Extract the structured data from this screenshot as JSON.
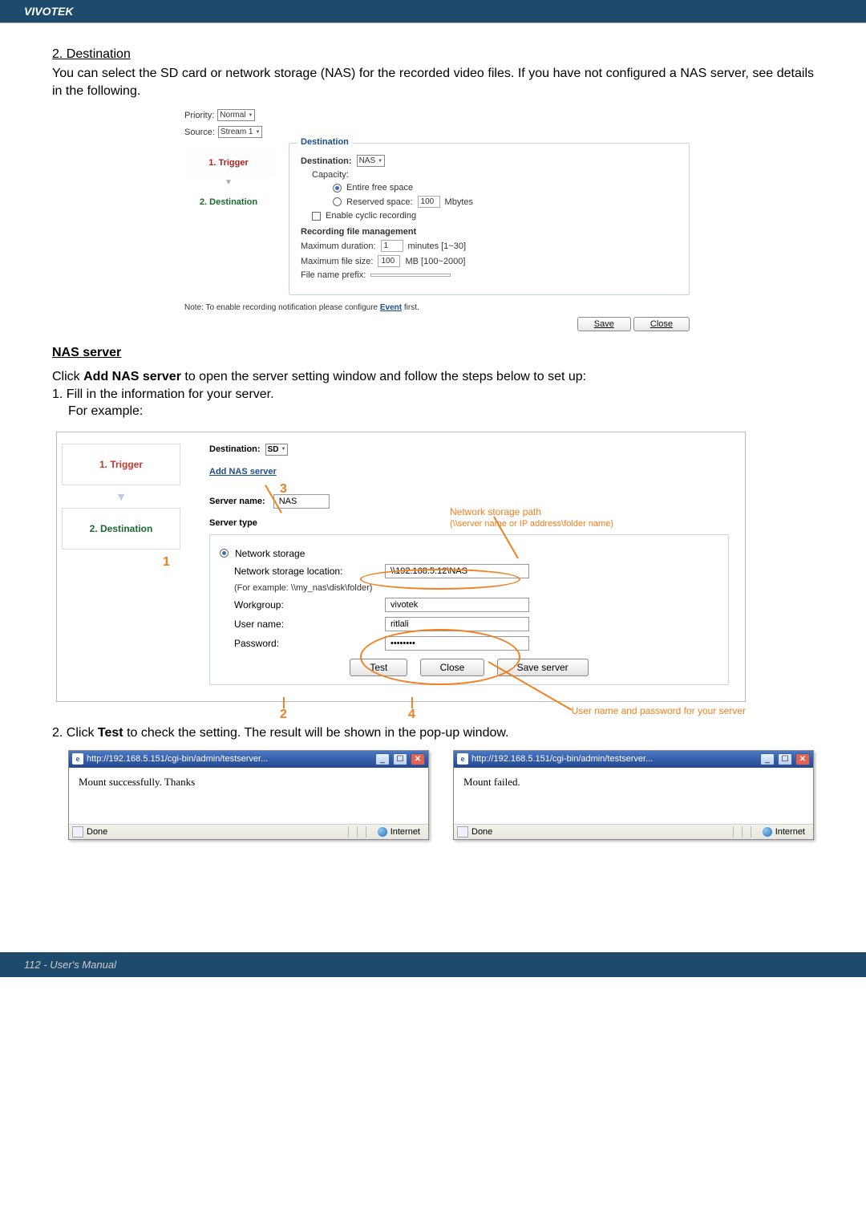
{
  "header": {
    "brand": "VIVOTEK"
  },
  "section_dest": {
    "num_title": "2. Destination",
    "para": "You can select the SD card or network storage (NAS) for the recorded video files. If you have not configured a NAS server, see details in the following."
  },
  "shot1": {
    "priority_label": "Priority:",
    "priority_value": "Normal",
    "source_label": "Source:",
    "source_value": "Stream 1",
    "step1": "1. Trigger",
    "step2": "2. Destination",
    "fs_legend": "Destination",
    "dest_label": "Destination:",
    "dest_value": "NAS",
    "capacity_label": "Capacity:",
    "entire": "Entire free space",
    "reserved": "Reserved space:",
    "reserved_val": "100",
    "reserved_unit": "Mbytes",
    "cyclic": "Enable cyclic recording",
    "rfm_label": "Recording file management",
    "maxdur": "Maximum duration:",
    "maxdur_val": "1",
    "maxdur_unit": "minutes [1~30]",
    "maxsize": "Maximum file size:",
    "maxsize_val": "100",
    "maxsize_unit": "MB [100~2000]",
    "prefix": "File name prefix:",
    "note_pre": "Note: To enable recording notification please configure ",
    "note_link": "Event",
    "note_post": " first.",
    "btn_save": "Save",
    "btn_close": "Close"
  },
  "nas": {
    "heading": "NAS server",
    "line1_pre": "Click ",
    "line1_bold": "Add NAS server",
    "line1_post": " to open the server setting window and follow the steps below to set up:",
    "line2": "1. Fill in the information for your server.",
    "line3": "For example:"
  },
  "shot2": {
    "step1": "1.  Trigger",
    "step2": "2.  Destination",
    "dest_label": "Destination:",
    "dest_value": "SD",
    "addnas": "Add NAS server",
    "server_name_label": "Server name:",
    "server_name_val": "NAS",
    "server_type_label": "Server type",
    "nw_storage": "Network storage",
    "loc_label": "Network storage location:",
    "loc_val": "\\\\192.168.5.12\\NAS",
    "example": "(For example: \\\\my_nas\\disk\\folder)",
    "workgroup_label": "Workgroup:",
    "workgroup_val": "vivotek",
    "user_label": "User name:",
    "user_val": "ritlali",
    "pass_label": "Password:",
    "pass_val": "••••••••",
    "btn_test": "Test",
    "btn_close": "Close",
    "btn_save": "Save server",
    "ann3": "3",
    "ann1": "1",
    "ann2": "2",
    "ann4": "4",
    "ann_path_title": "Network storage path",
    "ann_path_sub": "(\\\\server name or IP address\\folder name)",
    "ann_userpass": "User name and password for your server"
  },
  "test_line": {
    "pre": "2. Click ",
    "bold": "Test",
    "post": " to check the setting. The result will be shown in the pop-up window."
  },
  "popup": {
    "url": "http://192.168.5.151/cgi-bin/admin/testserver...",
    "success": "Mount successfully. Thanks",
    "fail": "Mount failed.",
    "done": "Done",
    "internet": "Internet"
  },
  "footer": {
    "text": "112 - User's Manual"
  }
}
